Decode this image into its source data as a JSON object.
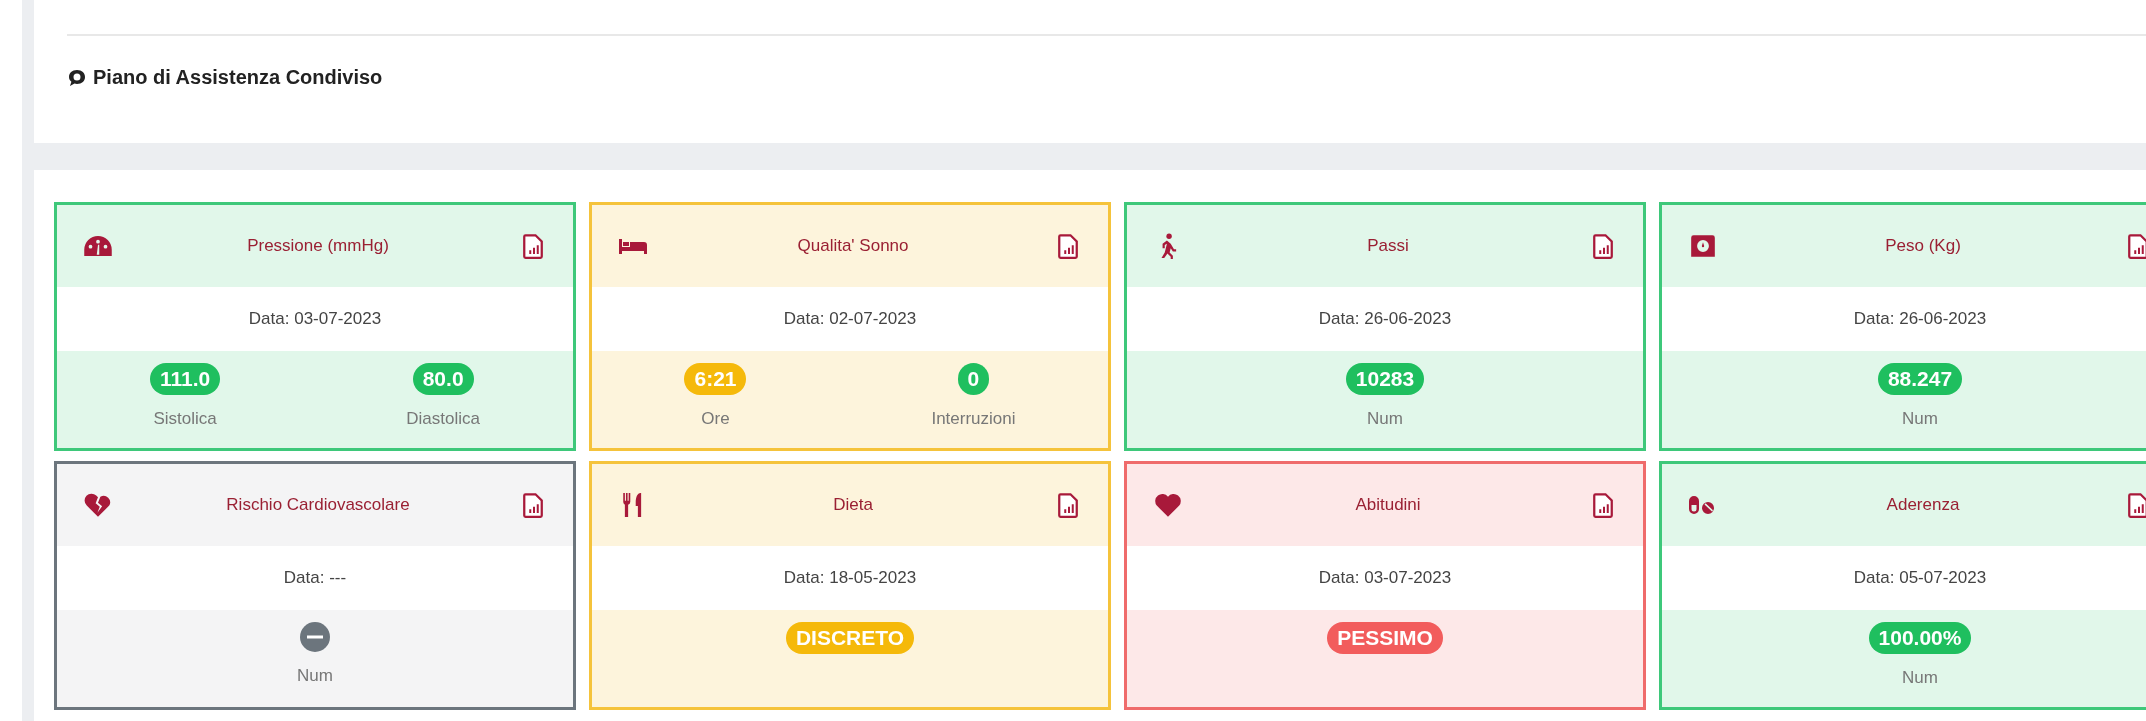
{
  "panel": {
    "title": "Piano di Assistenza Condiviso"
  },
  "cards": [
    {
      "title": "Pressione (mmHg)",
      "kind": "gauge",
      "color": "#3ec87a",
      "date": "Data: 03-07-2023",
      "values": [
        {
          "kind": "pill",
          "value": "111.0",
          "label": "Sistolica",
          "color": "#1fbf5f"
        },
        {
          "kind": "pill",
          "value": "80.0",
          "label": "Diastolica",
          "color": "#1fbf5f"
        }
      ]
    },
    {
      "title": "Qualita' Sonno",
      "kind": "bed",
      "color": "#f5c33b",
      "date": "Data: 02-07-2023",
      "values": [
        {
          "kind": "pill",
          "value": "6:21",
          "label": "Ore",
          "color": "#f5b90a"
        },
        {
          "kind": "pill",
          "value": "0",
          "label": "Interruzioni",
          "color": "#1fbf5f"
        }
      ]
    },
    {
      "title": "Passi",
      "kind": "walker",
      "color": "#3ec87a",
      "date": "Data: 26-06-2023",
      "values": [
        {
          "kind": "pill",
          "value": "10283",
          "label": "Num",
          "color": "#1fbf5f"
        }
      ]
    },
    {
      "title": "Peso (Kg)",
      "kind": "scale",
      "color": "#3ec87a",
      "date": "Data: 26-06-2023",
      "values": [
        {
          "kind": "pill",
          "value": "88.247",
          "label": "Num",
          "color": "#1fbf5f"
        }
      ]
    },
    {
      "title": "Rischio Cardiovascolare",
      "kind": "risk",
      "color": "#6c757d",
      "date": "Data: ---",
      "values": [
        {
          "kind": "empty",
          "label": "Num",
          "color": "#6c757d"
        }
      ]
    },
    {
      "title": "Dieta",
      "kind": "diet",
      "color": "#f5c33b",
      "date": "Data: 18-05-2023",
      "values": [
        {
          "kind": "pill",
          "value": "DISCRETO",
          "color": "#f5b90a"
        }
      ]
    },
    {
      "title": "Abitudini",
      "kind": "habits",
      "color": "#ef6b6b",
      "date": "Data: 03-07-2023",
      "values": [
        {
          "kind": "pill",
          "value": "PESSIMO",
          "color": "#f25c5c"
        }
      ]
    },
    {
      "title": "Aderenza",
      "kind": "adherence",
      "color": "#3ec87a",
      "date": "Data: 05-07-2023",
      "values": [
        {
          "kind": "pill",
          "value": "100.00%",
          "label": "Num",
          "color": "#1fbf5f"
        }
      ]
    }
  ]
}
